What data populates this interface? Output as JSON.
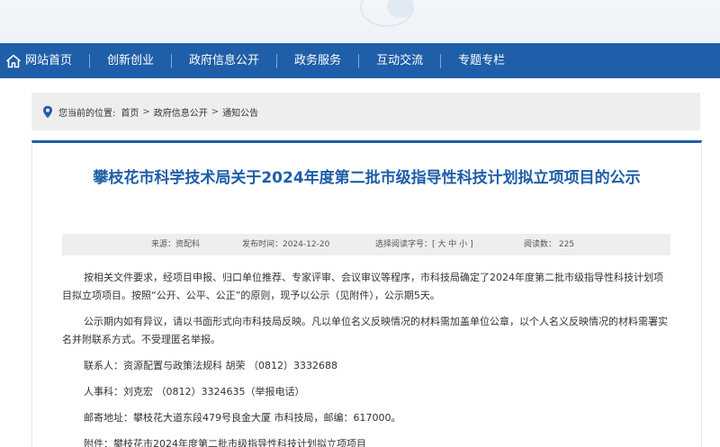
{
  "nav": {
    "home": "网站首页",
    "items": [
      "创新创业",
      "政府信息公开",
      "政务服务",
      "互动交流",
      "专题专栏"
    ]
  },
  "breadcrumb": {
    "prefix": "您当前的位置:",
    "items": [
      "首页",
      "政府信息公开",
      "通知公告"
    ],
    "sep": ">"
  },
  "article": {
    "title": "攀枝花市科学技术局关于2024年度第二批市级指导性科技计划拟立项项目的公示",
    "meta": {
      "source": "来源：资配科",
      "date": "发布时间：2024-12-20",
      "font_label": "选择阅读字号：[",
      "font_large": "大",
      "font_medium": "中",
      "font_small": "小",
      "font_close": "]",
      "views": "阅读数：  225"
    },
    "paragraphs": [
      "按相关文件要求，经项目申报、归口单位推荐、专家评审、会议审议等程序，市科技局确定了2024年度第二批市级指导性科技计划项目拟立项项目。按照“公开、公平、公正”的原则，现予以公示（见附件），公示期5天。",
      "公示期内如有异议，请以书面形式向市科技局反映。凡以单位名义反映情况的材料需加盖单位公章，以个人名义反映情况的材料需署实名并附联系方式。不受理匿名举报。"
    ],
    "contacts": [
      "联系人：资源配置与政策法规科 胡荣 （0812）3332688",
      "人事科：刘克宏 （0812）3324635（举报电话）",
      "邮寄地址：攀枝花大道东段479号良金大厦 市科技局，邮编：617000。",
      "附件：攀枝花市2024年度第二批市级指导性科技计划拟立项项目"
    ]
  },
  "colors": {
    "nav_bg": "#1f5ea8",
    "title": "#1f5ea8",
    "crumb_bg": "#eeeeee"
  }
}
